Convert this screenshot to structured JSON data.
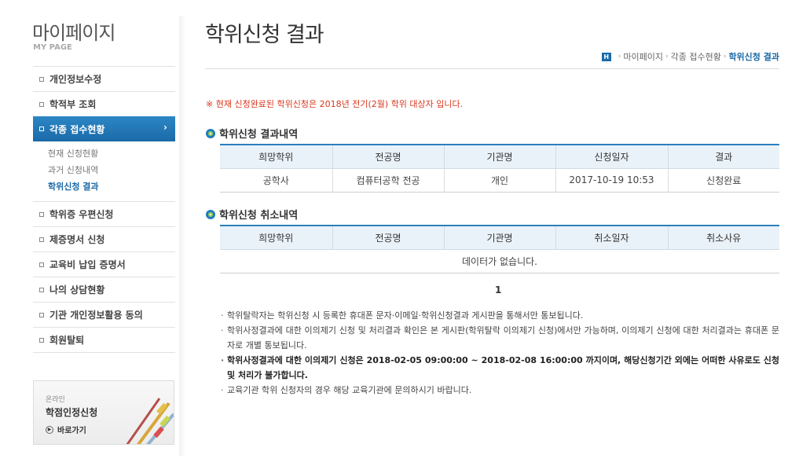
{
  "sidebar": {
    "title": "마이페이지",
    "subtitle": "MY PAGE",
    "items": [
      {
        "label": "개인정보수정"
      },
      {
        "label": "학적부 조회"
      },
      {
        "label": "각종 접수현황"
      },
      {
        "label": "학위증 우편신청"
      },
      {
        "label": "제증명서 신청"
      },
      {
        "label": "교육비 납입 증명서"
      },
      {
        "label": "나의 상담현황"
      },
      {
        "label": "기관 개인정보활용 동의"
      },
      {
        "label": "회원탈퇴"
      }
    ],
    "active_arrow": "›",
    "submenu": [
      {
        "label": "현재 신청현황"
      },
      {
        "label": "과거 신청내역"
      },
      {
        "label": "학위신청 결과"
      }
    ],
    "banner": {
      "small": "온라인",
      "main": "학점인정신청",
      "link": "바로가기"
    }
  },
  "main": {
    "title": "학위신청 결과",
    "breadcrumb": {
      "home": "H",
      "items": [
        "마이페이지",
        "각종 접수현황",
        "학위신청 결과"
      ],
      "separator": "›"
    },
    "notice": "※ 현재 신청완료된 학위신청은 2018년 전기(2월) 학위 대상자 입니다.",
    "result_section": {
      "title": "학위신청 결과내역",
      "headers": [
        "희망학위",
        "전공명",
        "기관명",
        "신청일자",
        "결과"
      ],
      "rows": [
        [
          "공학사",
          "컴퓨터공학 전공",
          "개인",
          "2017-10-19 10:53",
          "신청완료"
        ]
      ]
    },
    "cancel_section": {
      "title": "학위신청 취소내역",
      "headers": [
        "희망학위",
        "전공명",
        "기관명",
        "취소일자",
        "취소사유"
      ],
      "empty": "데이터가 없습니다."
    },
    "pagination": {
      "current": "1"
    },
    "notes": [
      "학위탈락자는 학위신청 시 등록한 휴대폰 문자·이메일·학위신청결과 게시판을 통해서만 통보됩니다.",
      "학위사정결과에 대한 이의제기 신청 및 처리결과 확인은 본 게시판(학위탈락 이의제기 신청)에서만 가능하며, 이의제기 신청에 대한 처리결과는 휴대폰 문자로 개별 통보됩니다.",
      "학위사정결과에 대한 이의제기 신청은 2018-02-05 09:00:00 ~ 2018-02-08 16:00:00 까지이며, 해당신청기간 외에는 어떠한 사유로도 신청 및 처리가 불가합니다.",
      "교육기관 학위 신청자의 경우 해당 교육기관에 문의하시기 바랍니다."
    ]
  },
  "colors": {
    "accent": "#1b6aa8",
    "notice": "#d9361c",
    "table_header_bg": "#eaf2f9"
  }
}
